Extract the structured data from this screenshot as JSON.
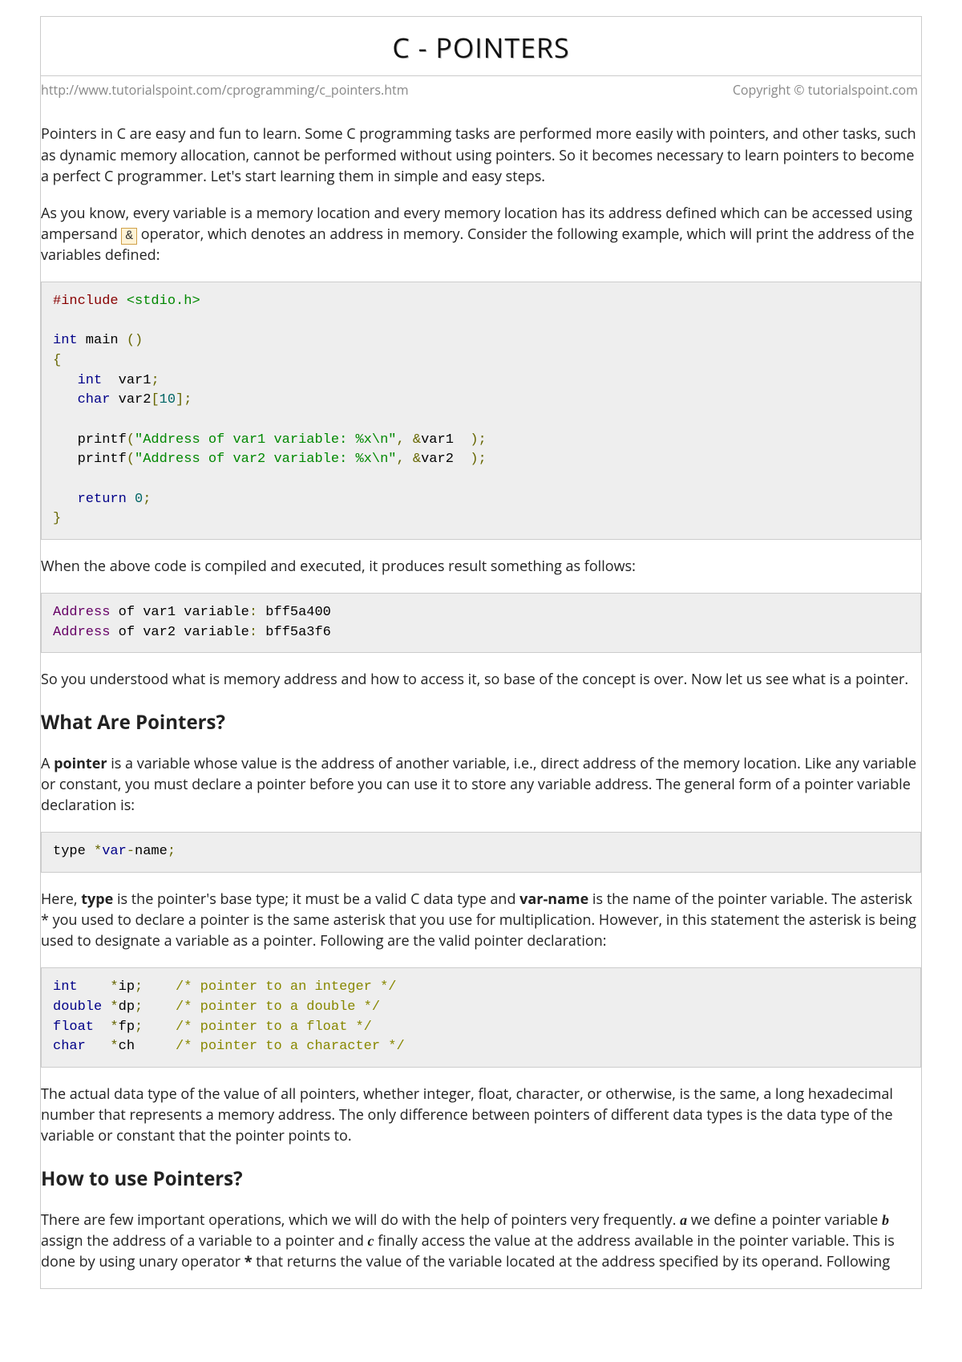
{
  "title": "C - POINTERS",
  "url": "http://www.tutorialspoint.com/cprogramming/c_pointers.htm",
  "copyright": "Copyright © tutorialspoint.com",
  "intro1": "Pointers in C are easy and fun to learn. Some C programming tasks are performed more easily with pointers, and other tasks, such as dynamic memory allocation, cannot be performed without using pointers. So it becomes necessary to learn pointers to become a perfect C programmer. Let's start learning them in simple and easy steps.",
  "intro2a": "As you know, every variable is a memory location and every memory location has its address defined which can be accessed using ampersand ",
  "amp": "&",
  "intro2b": " operator, which denotes an address in memory. Consider the following example, which will print the address of the variables defined:",
  "code1": {
    "l1a": "#include",
    "l1b": " <stdio.h>",
    "l2a": "int",
    "l2b": " main ",
    "l2c": "()",
    "l3": "{",
    "l4a": "   ",
    "l4b": "int",
    "l4c": "  var1",
    "l4d": ";",
    "l5a": "   ",
    "l5b": "char",
    "l5c": " var2",
    "l5d": "[",
    "l5e": "10",
    "l5f": "];",
    "l6a": "   printf",
    "l6b": "(",
    "l6c": "\"Address of var1 variable: %x\\n\"",
    "l6d": ",",
    "l6e": " ",
    "l6f": "&",
    "l6g": "var1  ",
    "l6h": ");",
    "l7a": "   printf",
    "l7b": "(",
    "l7c": "\"Address of var2 variable: %x\\n\"",
    "l7d": ",",
    "l7e": " ",
    "l7f": "&",
    "l7g": "var2  ",
    "l7h": ");",
    "l8a": "   ",
    "l8b": "return",
    "l8c": " ",
    "l8d": "0",
    "l8e": ";",
    "l9": "}"
  },
  "para_after_code1": "When the above code is compiled and executed, it produces result something as follows:",
  "output1": {
    "l1a": "Address",
    "l1b": " of var1 variable",
    "l1c": ":",
    "l1d": " bff5a400",
    "l2a": "Address",
    "l2b": " of var2 variable",
    "l2c": ":",
    "l2d": " bff5a3f6"
  },
  "para_after_output1": "So you understood what is memory address and how to access it, so base of the concept is over. Now let us see what is a pointer.",
  "h2_1": "What Are Pointers?",
  "para_what1a": "A ",
  "para_what1_bold": "pointer",
  "para_what1b": " is a variable whose value is the address of another variable, i.e., direct address of the memory location. Like any variable or constant, you must declare a pointer before you can use it to store any variable address. The general form of a pointer variable declaration is:",
  "code2": {
    "a": "type ",
    "b": "*",
    "c": "var",
    "d": "-",
    "e": "name",
    "f": ";"
  },
  "para_here1": "Here, ",
  "para_here_bold1": "type",
  "para_here2": " is the pointer's base type; it must be a valid C data type and ",
  "para_here_bold2": "var-name",
  "para_here3": " is the name of the pointer variable. The asterisk * you used to declare a pointer is the same asterisk that you use for multiplication. However, in this statement the asterisk is being used to designate a variable as a pointer. Following are the valid pointer declaration:",
  "code3": {
    "l1a": "int",
    "l1b": "    ",
    "l1c": "*",
    "l1d": "ip",
    "l1e": ";",
    "l1f": "    ",
    "l1g": "/* pointer to an integer */",
    "l2a": "double",
    "l2b": " ",
    "l2c": "*",
    "l2d": "dp",
    "l2e": ";",
    "l2f": "    ",
    "l2g": "/* pointer to a double */",
    "l3a": "float",
    "l3b": "  ",
    "l3c": "*",
    "l3d": "fp",
    "l3e": ";",
    "l3f": "    ",
    "l3g": "/* pointer to a float */",
    "l4a": "char",
    "l4b": "   ",
    "l4c": "*",
    "l4d": "ch     ",
    "l4g": "/* pointer to a character */"
  },
  "para_actual": "The actual data type of the value of all pointers, whether integer, float, character, or otherwise, is the same, a long hexadecimal number that represents a memory address. The only difference between pointers of different data types is the data type of the variable or constant that the pointer points to.",
  "h2_2": "How to use Pointers?",
  "howto": {
    "p1": "There are few important operations, which we will do with the help of pointers very frequently. ",
    "a": "a",
    "p2": " we define a pointer variable ",
    "b": "b",
    "p3": " assign the address of a variable to a pointer and ",
    "c": "c",
    "p4": " finally access the value at the address available in the pointer variable. This is done by using unary operator ",
    "star": "*",
    "p5": " that returns the value of the variable located at the address specified by its operand. Following"
  }
}
